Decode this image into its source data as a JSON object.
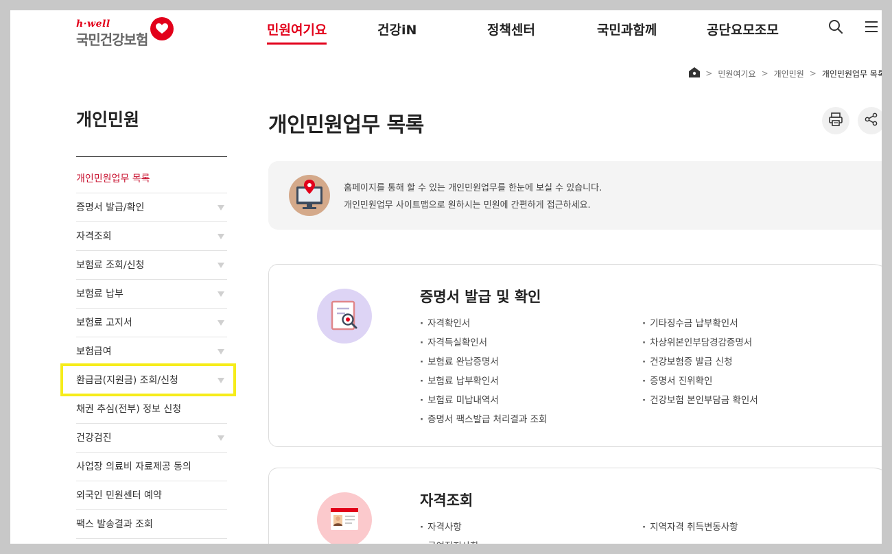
{
  "header": {
    "logo_small": "h·well",
    "logo_main": "국민건강보험",
    "nav": [
      "민원여기요",
      "건강iN",
      "정책센터",
      "국민과함께",
      "공단요모조모"
    ],
    "active_nav_index": 0,
    "icons": [
      "search-icon",
      "menu-icon"
    ],
    "accent_color": "#e2001a"
  },
  "breadcrumb": {
    "home_icon": "home-icon",
    "items": [
      "민원여기요",
      "개인민원",
      "개인민원업무 목록"
    ]
  },
  "lnb": {
    "title": "개인민원",
    "items": [
      {
        "label": "개인민원업무 목록",
        "active": true,
        "has_arrow": false
      },
      {
        "label": "증명서 발급/확인",
        "has_arrow": true
      },
      {
        "label": "자격조회",
        "has_arrow": true
      },
      {
        "label": "보험료 조회/신청",
        "has_arrow": true
      },
      {
        "label": "보험료 납부",
        "has_arrow": true
      },
      {
        "label": "보험료 고지서",
        "has_arrow": true
      },
      {
        "label": "보험급여",
        "has_arrow": true
      },
      {
        "label": "환급금(지원금) 조회/신청",
        "has_arrow": true
      },
      {
        "label": "채권 추심(전부) 정보 신청",
        "has_arrow": false
      },
      {
        "label": "건강검진",
        "has_arrow": true
      },
      {
        "label": "사업장 의료비 자료제공 동의",
        "has_arrow": false
      },
      {
        "label": "외국인 민원센터 예약",
        "has_arrow": false
      },
      {
        "label": "팩스 발송결과 조회",
        "has_arrow": false
      }
    ],
    "highlight_color": "#f6ec1a"
  },
  "main": {
    "title": "개인민원업무 목록",
    "action_icons": [
      "print-icon",
      "share-icon"
    ],
    "info": {
      "icon": "monitor-location-icon",
      "lines": [
        "홈페이지를 통해 할 수 있는 개인민원업무를 한눈에 보실 수 있습니다.",
        "개인민원업무 사이트맵으로 원하시는 민원에 간편하게 접근하세요."
      ]
    },
    "cards": [
      {
        "title": "증명서 발급 및 확인",
        "icon": "certificate-search-icon",
        "left": [
          "자격확인서",
          "자격득실확인서",
          "보험료 완납증명서",
          "보험료 납부확인서",
          "보험료 미납내역서",
          "증명서 팩스발급 처리결과 조회"
        ],
        "right": [
          "기타징수금 납부확인서",
          "차상위본인부담경감증명서",
          "건강보험증 발급 신청",
          "증명서 진위확인",
          "건강보험 본인부담금 확인서"
        ]
      },
      {
        "title": "자격조회",
        "icon": "id-card-icon",
        "left": [
          "자격사항",
          "급여정지사항"
        ],
        "right": [
          "지역자격 취득변동사항"
        ]
      }
    ]
  }
}
